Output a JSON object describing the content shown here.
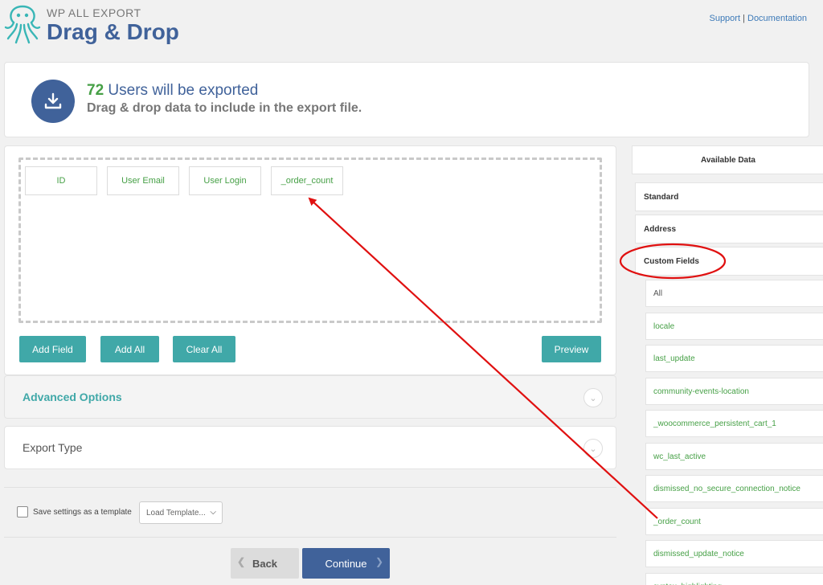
{
  "header": {
    "brand_small": "WP ALL EXPORT",
    "brand_title": "Drag & Drop",
    "support_link": "Support",
    "separator": "|",
    "documentation_link": "Documentation"
  },
  "banner": {
    "count": "72",
    "count_suffix": "Users will be exported",
    "subtitle": "Drag & drop data to include in the export file."
  },
  "drop_zone": {
    "fields": [
      "ID",
      "User Email",
      "User Login",
      "_order_count"
    ]
  },
  "buttons": {
    "add_field": "Add Field",
    "add_all": "Add All",
    "clear_all": "Clear All",
    "preview": "Preview"
  },
  "accordions": {
    "advanced_options": "Advanced Options",
    "export_type": "Export Type"
  },
  "template": {
    "save_label": "Save settings as a template",
    "load_placeholder": "Load Template..."
  },
  "footer": {
    "back": "Back",
    "continue": "Continue"
  },
  "sidebar": {
    "title": "Available Data",
    "sections": [
      "Standard",
      "Address",
      "Custom Fields"
    ],
    "custom_fields": [
      "All",
      "locale",
      "last_update",
      "community-events-location",
      "_woocommerce_persistent_cart_1",
      "wc_last_active",
      "dismissed_no_secure_connection_notice",
      "_order_count",
      "dismissed_update_notice",
      "syntax_highlighting"
    ]
  },
  "colors": {
    "brand_blue": "#40629a",
    "teal": "#40a8a8",
    "green": "#46a046",
    "annotation_red": "#e01010"
  }
}
